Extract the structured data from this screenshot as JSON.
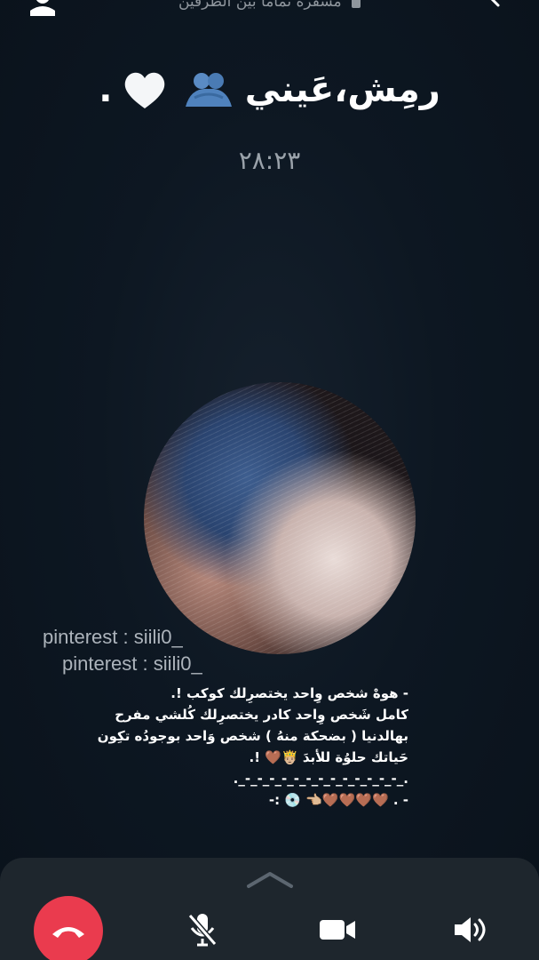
{
  "header": {
    "encryption_text": "مشفرة تماما بين الطرفين",
    "contact_name": "رمِش،عَيني",
    "name_suffix": "."
  },
  "call": {
    "duration": "٢٨:٢٣"
  },
  "watermarks": [
    "pinterest : siili0_",
    "pinterest : siili0_"
  ],
  "caption": {
    "lines": [
      "- هوهْ شخص وِاحد يختصرِلك كوكب !.",
      "كامل شَخص وِاحد كادر يختصرِلك كُلشي مفرح",
      "بهالدنيا ( بضحكة منهُ ) شخص وَاحد بوجودُه تكِون",
      "حَياتك حلوُة للأبدَ 🤴🏼🤎 !.",
      "._-_-_-_-_-_-_-_-_-_-_-_-_-_.",
      "- . 🤎🤎🤎🤎👈🏼 💿 :-"
    ]
  },
  "controls": {
    "end_call_icon": "end-call-icon",
    "mute_icon": "mic-off-icon",
    "video_icon": "video-camera-icon",
    "speaker_icon": "speaker-icon",
    "end_call_color": "#ea3b4e"
  }
}
